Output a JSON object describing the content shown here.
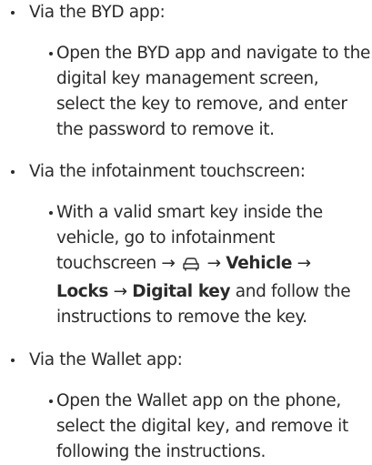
{
  "sections": [
    {
      "heading": "Via the BYD app:",
      "text": "Open the BYD app and navigate to the digital key management screen, select the key to remove, and enter the password to remove it."
    },
    {
      "heading": "Via the infotainment touchscreen:",
      "text_pre": "With a valid smart key inside the vehicle, go to infotainment touchscreen →",
      "arrow": "→",
      "vehicle": "Vehicle",
      "locks": "Locks",
      "digital_key": "Digital key",
      "text_post": "and follow the instructions to remove the key."
    },
    {
      "heading": "Via the Wallet app:",
      "text": "Open the Wallet app on the phone, select the digital key, and remove it following the instructions."
    }
  ],
  "icons": [
    "car-icon"
  ]
}
